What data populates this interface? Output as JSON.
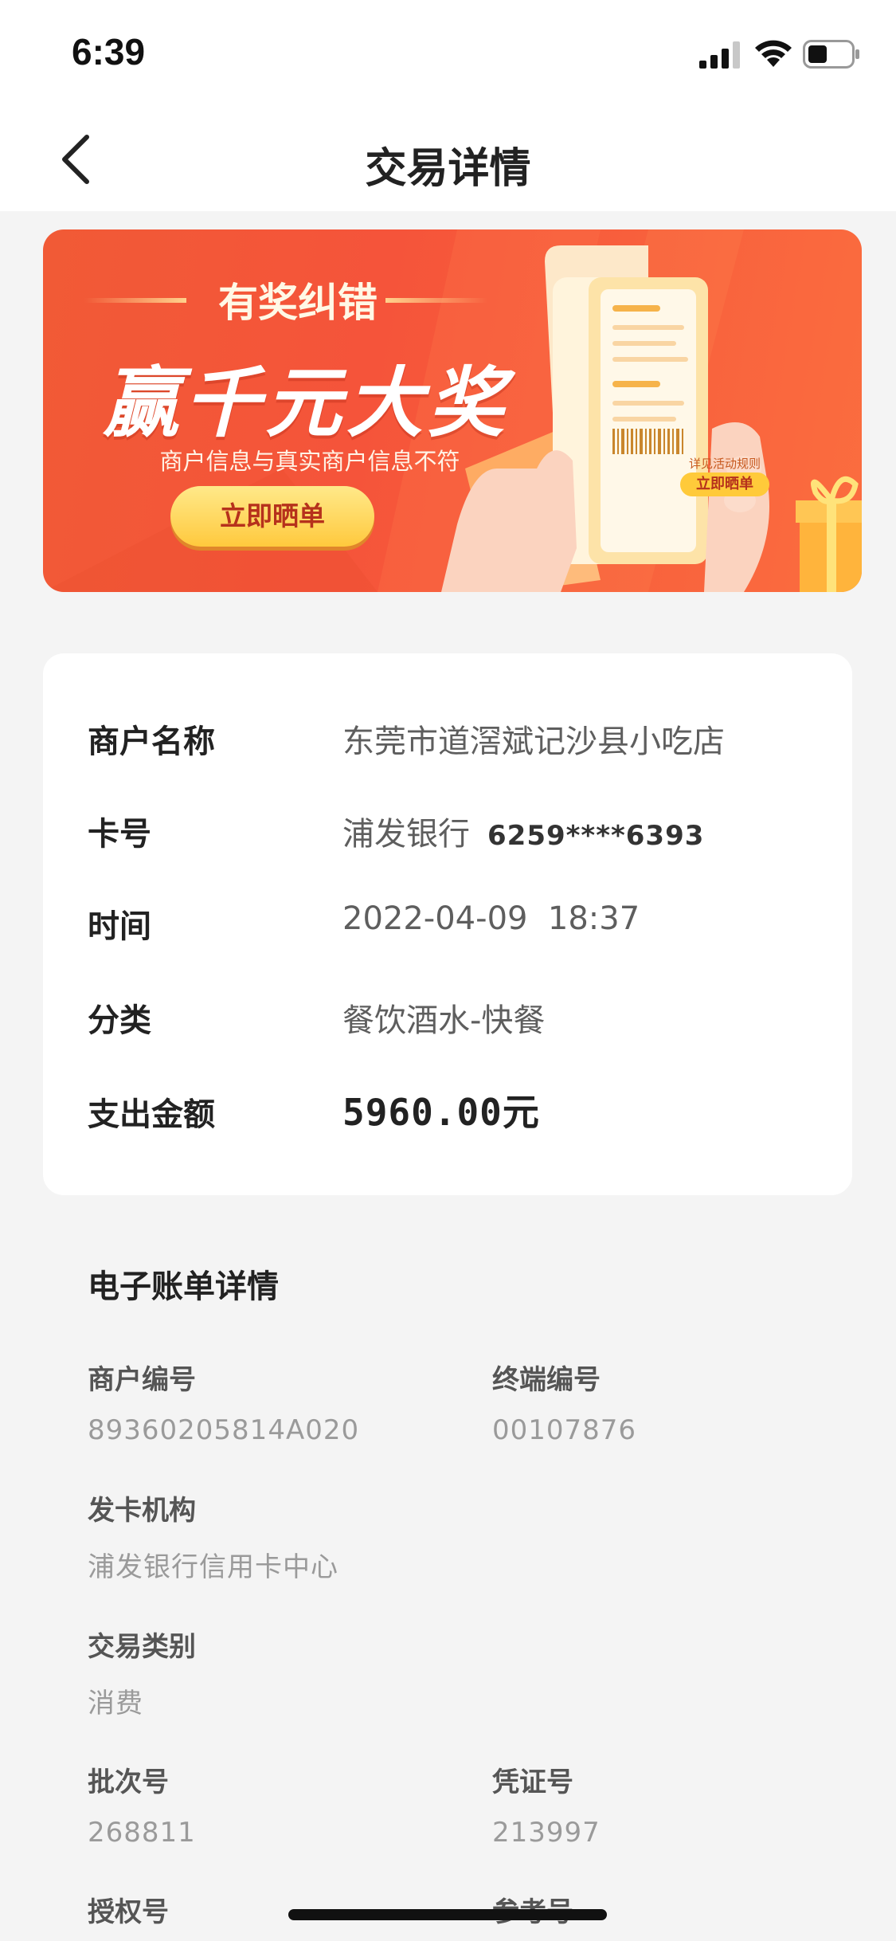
{
  "status_bar": {
    "time": "6:39"
  },
  "nav": {
    "title": "交易详情"
  },
  "banner": {
    "sub_heading": "有奖纠错",
    "headline": "赢千元大奖",
    "description": "商户信息与真实商户信息不符",
    "cta": "立即晒单",
    "receipt_rules": "详见活动规则",
    "receipt_cta": "立即晒单"
  },
  "transaction": {
    "merchant_name_label": "商户名称",
    "merchant_name": "东莞市道滘斌记沙县小吃店",
    "card_label": "卡号",
    "card_bank": "浦发银行",
    "card_number": "6259****6393",
    "time_label": "时间",
    "time": "2022-04-09  18:37",
    "category_label": "分类",
    "category": "餐饮酒水-快餐",
    "amount_label": "支出金额",
    "amount": "5960.00",
    "amount_unit": "元"
  },
  "ebill": {
    "title": "电子账单详情",
    "merchant_no_label": "商户编号",
    "merchant_no": "89360205814A020",
    "terminal_no_label": "终端编号",
    "terminal_no": "00107876",
    "issuer_label": "发卡机构",
    "issuer": "浦发银行信用卡中心",
    "txn_type_label": "交易类别",
    "txn_type": "消费",
    "batch_no_label": "批次号",
    "batch_no": "268811",
    "voucher_no_label": "凭证号",
    "voucher_no": "213997",
    "auth_no_label": "授权号",
    "ref_no_label": "参考号"
  },
  "colors": {
    "banner_primary": "#f15a36",
    "cta_yellow": "#ffc93d",
    "page_background": "#f4f4f4"
  }
}
